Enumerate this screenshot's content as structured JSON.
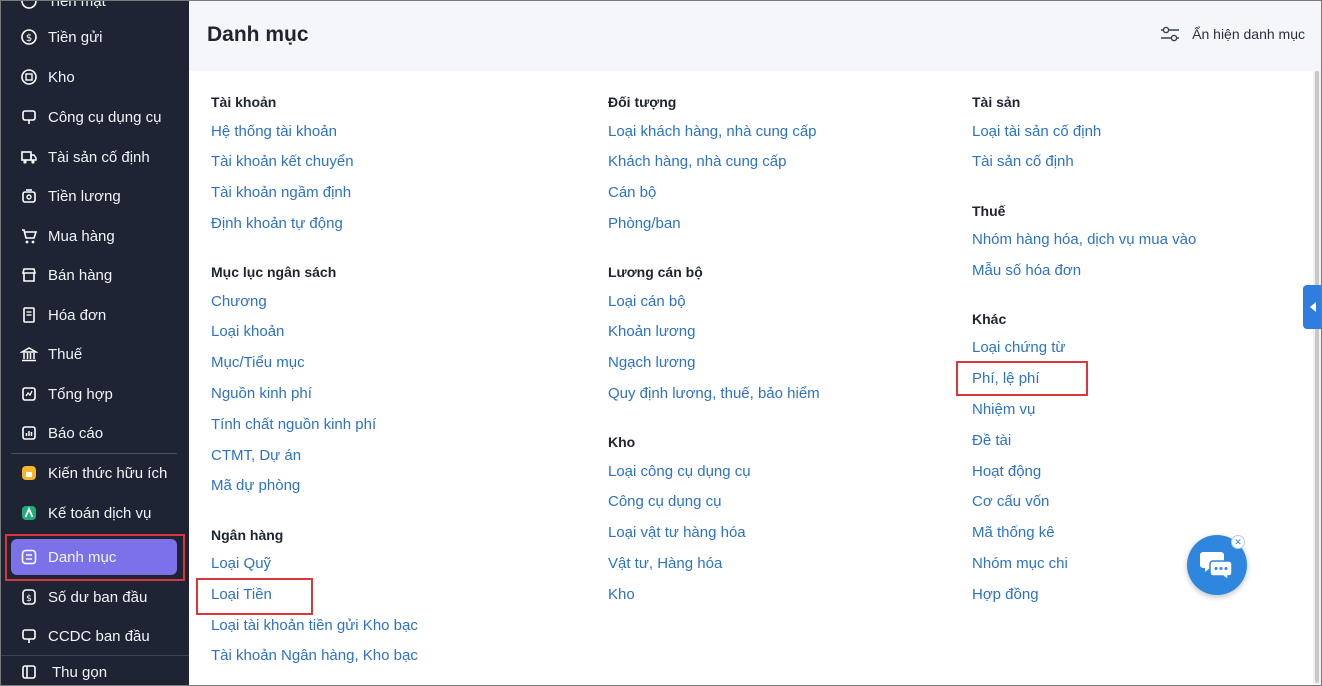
{
  "sidebar": {
    "top_partial": "Tiền mặt",
    "items": [
      {
        "label": "Tiền gửi",
        "icon": "deposit-icon"
      },
      {
        "label": "Kho",
        "icon": "warehouse-icon"
      },
      {
        "label": "Công cụ dụng cụ",
        "icon": "tools-icon"
      },
      {
        "label": "Tài sản cố định",
        "icon": "truck-icon"
      },
      {
        "label": "Tiền lương",
        "icon": "salary-icon"
      },
      {
        "label": "Mua hàng",
        "icon": "cart-icon"
      },
      {
        "label": "Bán hàng",
        "icon": "shop-icon"
      },
      {
        "label": "Hóa đơn",
        "icon": "invoice-icon"
      },
      {
        "label": "Thuế",
        "icon": "bank-icon"
      },
      {
        "label": "Tổng hợp",
        "icon": "summary-icon"
      },
      {
        "label": "Báo cáo",
        "icon": "report-icon"
      },
      {
        "label": "Kiến thức hữu ích",
        "icon": "knowledge-icon"
      },
      {
        "label": "Kế toán dịch vụ",
        "icon": "service-icon"
      },
      {
        "label": "Danh mục",
        "icon": "catalog-icon"
      },
      {
        "label": "Số dư ban đầu",
        "icon": "balance-icon"
      },
      {
        "label": "CCDC ban đầu",
        "icon": "tools-initial-icon"
      }
    ],
    "collapse_label": "Thu gọn"
  },
  "header": {
    "title": "Danh mục",
    "toggle_label": "Ẩn hiện danh mục"
  },
  "columns": {
    "col1": {
      "s1": {
        "title": "Tài khoản",
        "links": [
          "Hệ thống tài khoản",
          "Tài khoản kết chuyển",
          "Tài khoản ngầm định",
          "Định khoản tự động"
        ]
      },
      "s2": {
        "title": "Mục lục ngân sách",
        "links": [
          "Chương",
          "Loại khoản",
          "Mục/Tiểu mục",
          "Nguồn kinh phí",
          "Tính chất nguồn kinh phí",
          "CTMT, Dự án",
          "Mã dự phòng"
        ]
      },
      "s3": {
        "title": "Ngân hàng",
        "links": [
          "Loại Quỹ",
          "Loại Tiền",
          "Loại tài khoản tiền gửi Kho bạc",
          "Tài khoản Ngân hàng, Kho bạc"
        ]
      }
    },
    "col2": {
      "s1": {
        "title": "Đối tượng",
        "links": [
          "Loại khách hàng, nhà cung cấp",
          "Khách hàng, nhà cung cấp",
          "Cán bộ",
          "Phòng/ban"
        ]
      },
      "s2": {
        "title": "Lương cán bộ",
        "links": [
          "Loại cán bộ",
          "Khoản lương",
          "Ngạch lương",
          "Quy định lương, thuế, bảo hiểm"
        ]
      },
      "s3": {
        "title": "Kho",
        "links": [
          "Loại công cụ dụng cụ",
          "Công cụ dụng cụ",
          "Loại vật tư hàng hóa",
          "Vật tư, Hàng hóa",
          "Kho"
        ]
      }
    },
    "col3": {
      "s1": {
        "title": "Tài sản",
        "links": [
          "Loại tài sản cố định",
          "Tài sản cố định"
        ]
      },
      "s2": {
        "title": "Thuế",
        "links": [
          "Nhóm hàng hóa, dịch vụ mua vào",
          "Mẫu số hóa đơn"
        ]
      },
      "s3": {
        "title": "Khác",
        "links": [
          "Loại chứng từ",
          "Phí, lệ phí",
          "Nhiệm vụ",
          "Đề tài",
          "Hoạt động",
          "Cơ cấu vốn",
          "Mã thống kê",
          "Nhóm mục chi",
          "Hợp đồng"
        ]
      }
    }
  },
  "colors": {
    "sidebar_bg": "#1e2434",
    "active_bg": "#7b72ea",
    "link": "#2d72c6",
    "highlight": "#d9383a",
    "chat": "#2f86de"
  }
}
